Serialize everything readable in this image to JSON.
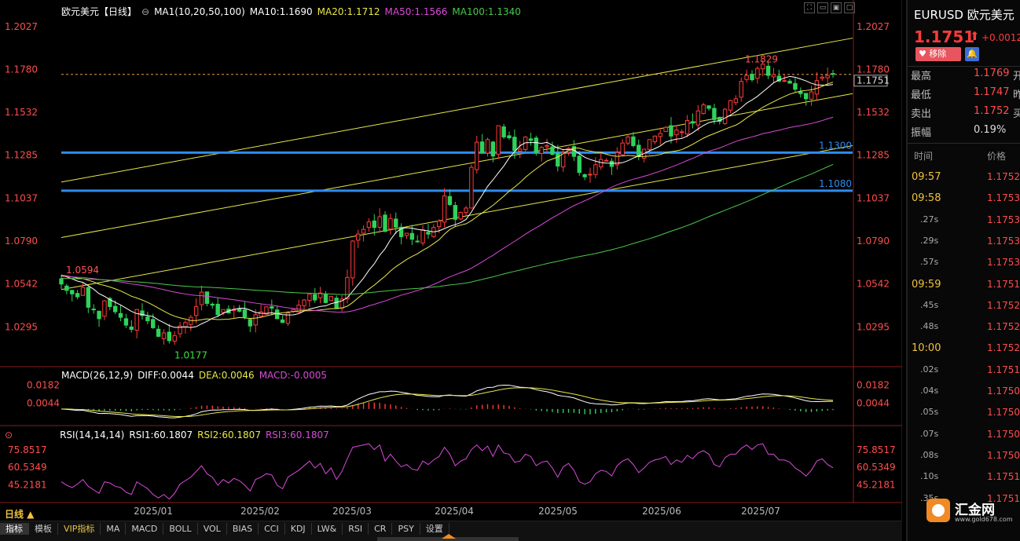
{
  "header": {
    "symbol": "欧元美元【日线】",
    "ma_label": "MA1(10,20,50,100)",
    "ma10": "MA10:1.1690",
    "ma20": "MA20:1.1712",
    "ma50": "MA50:1.1566",
    "ma100": "MA100:1.1340",
    "colors": {
      "ma10": "#ffffff",
      "ma20": "#e8e84a",
      "ma50": "#d84ad8",
      "ma100": "#4ac84a"
    }
  },
  "macd_header": {
    "label": "MACD(26,12,9)",
    "diff": "DIFF:0.0044",
    "dea": "DEA:0.0046",
    "macd": "MACD:-0.0005"
  },
  "rsi_header": {
    "label": "RSI(14,14,14)",
    "rsi1": "RSI1:60.1807",
    "rsi2": "RSI2:60.1807",
    "rsi3": "RSI3:60.1807"
  },
  "period_button": "日线 ▲",
  "bottom_tabs": [
    "指标",
    "模板",
    "VIP指标",
    "MA",
    "MACD",
    "BOLL",
    "VOL",
    "BIAS",
    "CCI",
    "KDJ",
    "LW&",
    "RSI",
    "CR",
    "PSY",
    "设置"
  ],
  "right_panel": {
    "title": "EURUSD 欧元美元",
    "price": "1.1751",
    "arrow": "⬆",
    "change": "+0.0012",
    "remove_btn": "♥ 移除",
    "bell_icon": "🔔",
    "stats": [
      {
        "k": "最高",
        "v": "1.1769",
        "k2": "开"
      },
      {
        "k": "最低",
        "v": "1.1747",
        "k2": "昨"
      },
      {
        "k": "卖出",
        "v": "1.1752",
        "k2": "买"
      },
      {
        "k": "振幅",
        "v": "0.19%",
        "k2": ""
      }
    ],
    "col_time": "时间",
    "col_price": "价格",
    "ticks": [
      {
        "t": "09:57",
        "p": "1.1752",
        "kind": "major"
      },
      {
        "t": "09:58",
        "p": "1.1753",
        "kind": "major"
      },
      {
        "t": ".27s",
        "p": "1.1753",
        "kind": "minor"
      },
      {
        "t": ".29s",
        "p": "1.1753",
        "kind": "minor"
      },
      {
        "t": ".57s",
        "p": "1.1753",
        "kind": "minor"
      },
      {
        "t": "09:59",
        "p": "1.1751",
        "kind": "major"
      },
      {
        "t": ".45s",
        "p": "1.1752",
        "kind": "minor"
      },
      {
        "t": ".48s",
        "p": "1.1752",
        "kind": "minor"
      },
      {
        "t": "10:00",
        "p": "1.1752",
        "kind": "major"
      },
      {
        "t": ".02s",
        "p": "1.1751",
        "kind": "minor"
      },
      {
        "t": ".04s",
        "p": "1.1750",
        "kind": "minor"
      },
      {
        "t": ".05s",
        "p": "1.1750",
        "kind": "minor"
      },
      {
        "t": ".07s",
        "p": "1.1750",
        "kind": "minor"
      },
      {
        "t": ".08s",
        "p": "1.1750",
        "kind": "minor"
      },
      {
        "t": ".10s",
        "p": "1.1751",
        "kind": "minor"
      },
      {
        "t": ".35s",
        "p": "1.1751",
        "kind": "minor"
      }
    ]
  },
  "watermark": {
    "text": "汇金网",
    "sub": "www.gold678.com"
  },
  "chart_data": {
    "type": "candlestick",
    "price_axis": [
      "1.2027",
      "1.1780",
      "1.1532",
      "1.1285",
      "1.1037",
      "1.0790",
      "1.0542",
      "1.0295"
    ],
    "price_ylim": [
      1.0097,
      1.2112
    ],
    "x_ticks": [
      "2025/01",
      "2025/02",
      "2025/03",
      "2025/04",
      "2025/05",
      "2025/06",
      "2025/07"
    ],
    "current_price_label": "1.1751",
    "horizontal_levels": [
      {
        "value": 1.13,
        "label": "1.1300"
      },
      {
        "value": 1.108,
        "label": "1.1080"
      }
    ],
    "annotations": [
      {
        "text": "1.0594",
        "value": 1.0594,
        "color": "#ff5555"
      },
      {
        "text": "1.0177",
        "value": 1.0177,
        "color": "#44dd44"
      },
      {
        "text": "1.1829",
        "value": 1.1829,
        "color": "#ff5555"
      }
    ],
    "closes": [
      1.0542,
      1.0505,
      1.0485,
      1.0468,
      1.0522,
      1.0408,
      1.0395,
      1.0342,
      1.0445,
      1.0412,
      1.0382,
      1.035,
      1.0305,
      1.028,
      1.0395,
      1.036,
      1.033,
      1.029,
      1.024,
      1.026,
      1.0215,
      1.0245,
      1.03,
      1.032,
      1.035,
      1.0412,
      1.0495,
      1.043,
      1.042,
      1.0365,
      1.0395,
      1.0375,
      1.0395,
      1.0385,
      1.0352,
      1.03,
      1.0365,
      1.0382,
      1.041,
      1.0403,
      1.0342,
      1.032,
      1.0375,
      1.0395,
      1.042,
      1.045,
      1.0483,
      1.045,
      1.049,
      1.0435,
      1.047,
      1.04,
      1.0455,
      1.058,
      1.079,
      1.083,
      1.0857,
      1.09,
      1.0868,
      1.093,
      1.0845,
      1.092,
      1.087,
      1.0815,
      1.0835,
      1.08,
      1.0788,
      1.0855,
      1.083,
      1.0868,
      1.0905,
      1.105,
      1.1,
      1.0915,
      1.0955,
      1.098,
      1.1215,
      1.136,
      1.13,
      1.1375,
      1.128,
      1.1455,
      1.139,
      1.1385,
      1.1312,
      1.132,
      1.139,
      1.137,
      1.13,
      1.133,
      1.134,
      1.129,
      1.1222,
      1.13,
      1.1325,
      1.1278,
      1.1185,
      1.116,
      1.1175,
      1.123,
      1.126,
      1.1255,
      1.122,
      1.13,
      1.1355,
      1.139,
      1.134,
      1.128,
      1.132,
      1.1375,
      1.1395,
      1.141,
      1.1445,
      1.1395,
      1.143,
      1.142,
      1.1485,
      1.147,
      1.154,
      1.1575,
      1.1555,
      1.149,
      1.148,
      1.155,
      1.16,
      1.161,
      1.171,
      1.1745,
      1.172,
      1.1785,
      1.181,
      1.1745,
      1.175,
      1.1712,
      1.1715,
      1.17,
      1.1665,
      1.164,
      1.161,
      1.165,
      1.1715,
      1.1735,
      1.1745,
      1.1751
    ],
    "moving_averages": [
      {
        "name": "MA10",
        "color": "#ffffff"
      },
      {
        "name": "MA20",
        "color": "#e8e84a"
      },
      {
        "name": "MA50",
        "color": "#d84ad8"
      },
      {
        "name": "MA100",
        "color": "#4ac84a"
      }
    ],
    "macd": {
      "axis": [
        "0.0182",
        "0.0044"
      ],
      "ylim": [
        -0.0115,
        0.0215
      ],
      "diff": 0.0044,
      "dea": 0.0046,
      "macd": -0.0005
    },
    "rsi": {
      "axis": [
        "75.8517",
        "60.5349",
        "45.2181"
      ],
      "ylim": [
        30,
        90
      ],
      "values": [
        48,
        45,
        43,
        46,
        50,
        44,
        41,
        38,
        48,
        47,
        44,
        43,
        39,
        37,
        48,
        45,
        42,
        37,
        34,
        37,
        33,
        38,
        46,
        49,
        52,
        57,
        62,
        55,
        52,
        45,
        50,
        47,
        51,
        49,
        45,
        40,
        50,
        52,
        55,
        54,
        45,
        42,
        52,
        55,
        58,
        62,
        66,
        60,
        64,
        55,
        60,
        50,
        57,
        68,
        78,
        79,
        80,
        81,
        76,
        80,
        66,
        72,
        66,
        61,
        63,
        59,
        58,
        66,
        63,
        67,
        70,
        78,
        72,
        62,
        66,
        68,
        76,
        80,
        75,
        79,
        70,
        80,
        73,
        72,
        65,
        66,
        72,
        70,
        62,
        65,
        66,
        60,
        52,
        61,
        64,
        58,
        48,
        46,
        48,
        55,
        58,
        57,
        53,
        62,
        66,
        68,
        63,
        56,
        60,
        65,
        67,
        68,
        70,
        63,
        67,
        65,
        71,
        68,
        73,
        75,
        72,
        63,
        61,
        69,
        72,
        72,
        77,
        80,
        76,
        80,
        81,
        72,
        72,
        67,
        67,
        65,
        60,
        57,
        53,
        58,
        66,
        68,
        63,
        60.1807
      ]
    }
  }
}
